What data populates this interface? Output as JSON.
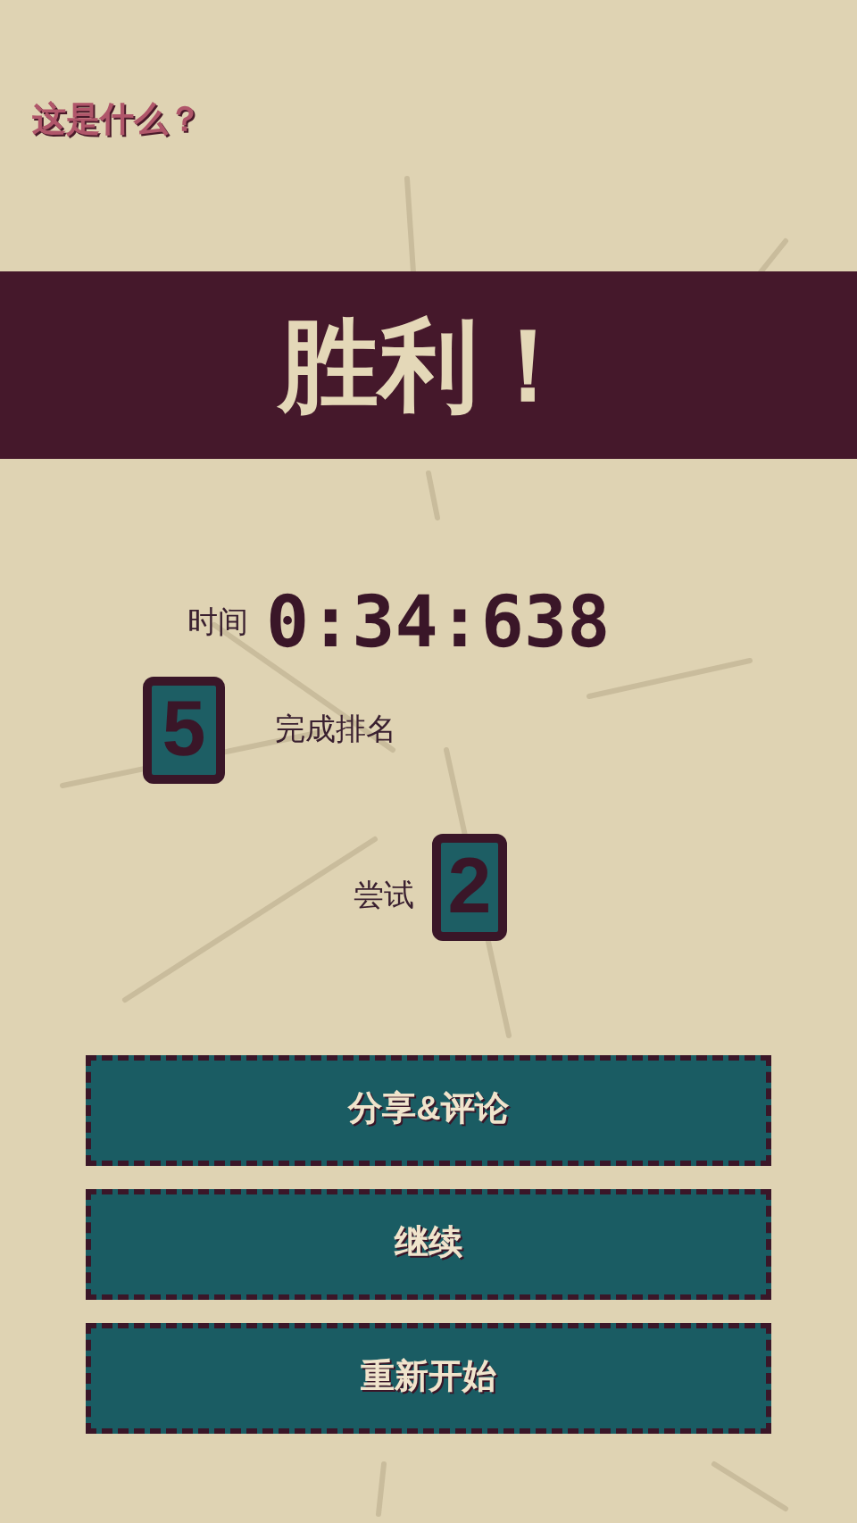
{
  "help_link": "这是什么？",
  "banner": {
    "title": "胜利！"
  },
  "time": {
    "label": "时间",
    "value": "0:34:638"
  },
  "rank": {
    "value": "5",
    "label": "完成排名"
  },
  "attempts": {
    "label": "尝试",
    "value": "2"
  },
  "buttons": [
    {
      "label": "分享&评论"
    },
    {
      "label": "继续"
    },
    {
      "label": "重新开始"
    }
  ]
}
